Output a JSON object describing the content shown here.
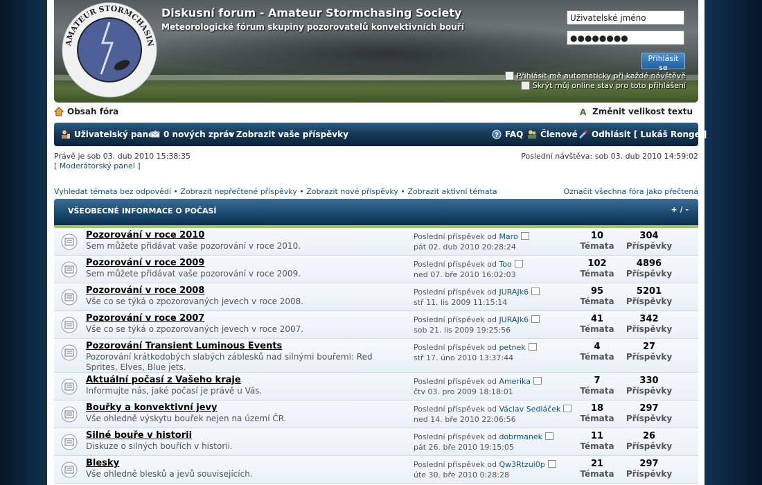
{
  "header": {
    "title": "Diskusní forum - Amateur Stormchasing Society",
    "description": "Meteorologické fórum skupiny pozorovatelů konvektivních bouří",
    "logo_text": "AMATEUR STORMCHASING SOCIETY"
  },
  "login": {
    "username_value": "Uživatelské jméno",
    "password_value": "●●●●●●●●",
    "button": "Přihlásit se",
    "auto_login": "Přihlásit mě automaticky při každé návštěvě",
    "hide_online": "Skrýt můj online stav pro toto přihlášení"
  },
  "nav": {
    "index": "Obsah fóra",
    "font_size": "Změnit velikost textu"
  },
  "bar": {
    "user_panel": "Uživatelský panel",
    "messages": "0 nových zpráv",
    "your_posts": "• Zobrazit vaše příspěvky",
    "faq": "FAQ",
    "members": "Členové",
    "logout": "Odhlásit [ Lukáš Ronge ]"
  },
  "info": {
    "current_time": "Právě je sob 03. dub 2010 15:38:35",
    "mod_panel": "[ Moderátorský panel ]",
    "last_visit": "Poslední návštěva: sob 03. dub 2010 14:59:02"
  },
  "quick_links": {
    "unanswered": "Vyhledat témata bez odpovědí",
    "unread": "Zobrazit nepřečtené příspěvky",
    "new": "Zobrazit nové příspěvky",
    "active": "Zobrazit aktivní témata",
    "mark_read": "Označit všechna fóra jako přečtená"
  },
  "category": {
    "title": "VŠEOBECNÉ INFORMACE O POČASÍ",
    "toggle": "+ / -"
  },
  "labels": {
    "last_post": "Poslední příspěvek od",
    "topics": "Témata",
    "posts": "Příspěvky"
  },
  "forums": [
    {
      "name": "Pozorování v roce 2010",
      "desc": "Sem můžete přidávat vaše pozorování v roce 2010.",
      "author": "Maro",
      "date": "pát 02. dub 2010 20:28:24",
      "topics": "10",
      "posts": "304"
    },
    {
      "name": "Pozorování v roce 2009",
      "desc": "Sem můžete přidávat vaše pozorování v roce 2009.",
      "author": "Too",
      "date": "ned 07. bře 2010 16:02:03",
      "topics": "102",
      "posts": "4896"
    },
    {
      "name": "Pozorování v roce 2008",
      "desc": "Vše co se týká o zpozorovaných jevech v roce 2008.",
      "author": "JURAJk6",
      "date": "stř 11. lis 2009 11:15:14",
      "topics": "95",
      "posts": "5201"
    },
    {
      "name": "Pozorování v roce 2007",
      "desc": "Vše co se týká o zpozorovaných jevech v roce 2007.",
      "author": "JURAJk6",
      "date": "sob 21. lis 2009 19:25:56",
      "topics": "41",
      "posts": "342"
    },
    {
      "name": "Pozorování Transient Luminous Events",
      "desc": "Pozorování krátkodobých slabých záblesků nad silnými bouřemi: Red Sprites, Elves, Blue jets.",
      "author": "petnek",
      "date": "stř 17. úno 2010 13:37:44",
      "topics": "4",
      "posts": "27"
    },
    {
      "name": "Aktuální počasí z Vašeho kraje",
      "desc": "Informujte nás, jaké počasí je právě u Vás.",
      "author": "Amerika",
      "date": "čtv 03. pro 2009 18:18:01",
      "topics": "7",
      "posts": "330"
    },
    {
      "name": "Bouřky a konvektivní jevy",
      "desc": "Vše ohledně výskytu bouřek nejen na území ČR.",
      "author": "Václav Sedláček",
      "date": "ned 14. bře 2010 22:06:56",
      "topics": "18",
      "posts": "297"
    },
    {
      "name": "Silné bouře v historii",
      "desc": "Diskuze o silných bouřích v historii.",
      "author": "dobrmanek",
      "date": "pát 26. bře 2010 19:15:05",
      "topics": "11",
      "posts": "26"
    },
    {
      "name": "Blesky",
      "desc": "Vše ohledně blesků a jevů souvisejících.",
      "author": "Qw3Rtzui0p",
      "date": "úte 30. bře 2010 0:28:28",
      "topics": "21",
      "posts": "297"
    }
  ]
}
